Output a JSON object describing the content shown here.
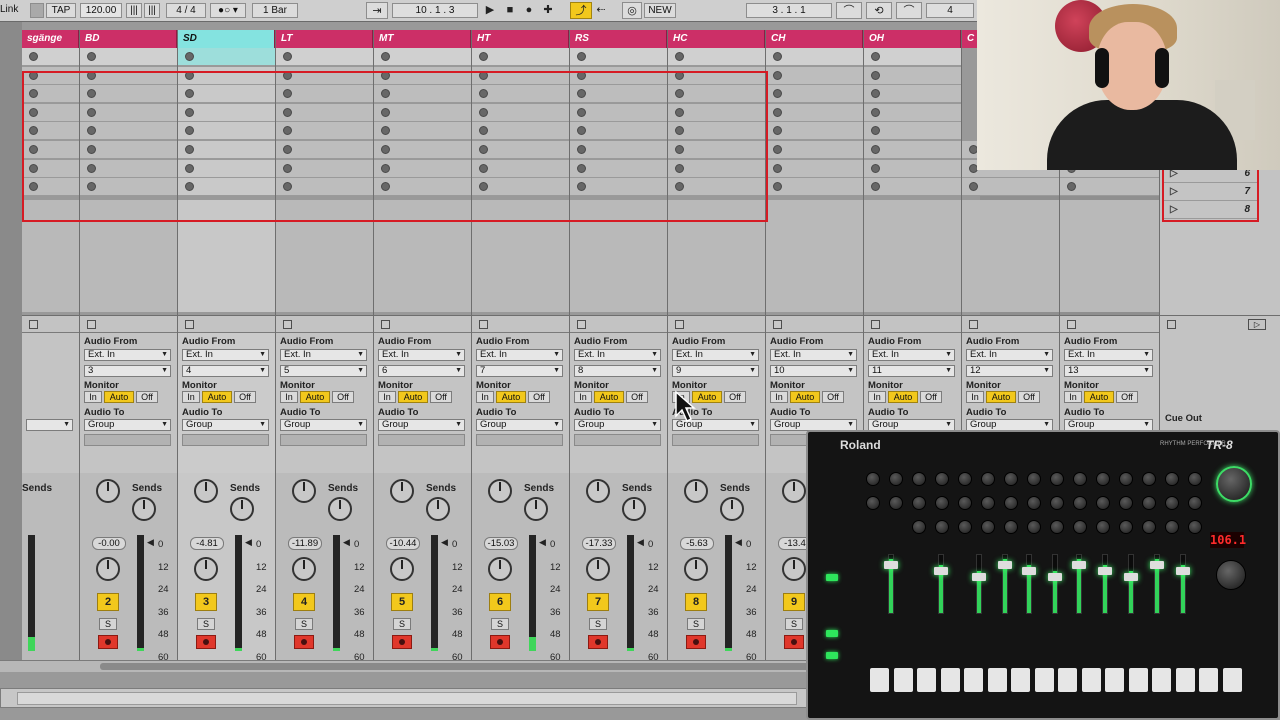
{
  "transport": {
    "link_label": "Link",
    "tap_label": "TAP",
    "tempo": "120.00",
    "meter_glyph": "|||",
    "time_signature": "4 / 4",
    "quantize": "1 Bar",
    "position": "10 .   1 .   3",
    "new_label": "NEW",
    "loop_position": "3 .   1 .   1",
    "loop_length": "4"
  },
  "tracks": [
    {
      "name": "sgänge",
      "input_channel": "",
      "volume": "",
      "number": "",
      "selected": false,
      "partial": true
    },
    {
      "name": "BD",
      "input_channel": "3",
      "volume": "-0.00",
      "number": "2",
      "selected": false
    },
    {
      "name": "SD",
      "input_channel": "4",
      "volume": "-4.81",
      "number": "3",
      "selected": true
    },
    {
      "name": "LT",
      "input_channel": "5",
      "volume": "-11.89",
      "number": "4",
      "selected": false
    },
    {
      "name": "MT",
      "input_channel": "6",
      "volume": "-10.44",
      "number": "5",
      "selected": false
    },
    {
      "name": "HT",
      "input_channel": "7",
      "volume": "-15.03",
      "number": "6",
      "selected": false
    },
    {
      "name": "RS",
      "input_channel": "8",
      "volume": "-17.33",
      "number": "7",
      "selected": false
    },
    {
      "name": "HC",
      "input_channel": "9",
      "volume": "-5.63",
      "number": "8",
      "selected": false
    },
    {
      "name": "CH",
      "input_channel": "10",
      "volume": "-13.4",
      "number": "9",
      "selected": false
    },
    {
      "name": "OH",
      "input_channel": "11",
      "volume": "",
      "number": "",
      "selected": false
    },
    {
      "name": "C",
      "input_channel": "12",
      "volume": "",
      "number": "",
      "selected": false
    },
    {
      "name": "",
      "input_channel": "13",
      "volume": "",
      "number": "",
      "selected": false
    }
  ],
  "io_labels": {
    "audio_from": "Audio From",
    "ext_in": "Ext. In",
    "monitor": "Monitor",
    "in": "In",
    "auto": "Auto",
    "off": "Off",
    "audio_to": "Audio To",
    "group": "Group",
    "sends": "Sends",
    "solo": "S"
  },
  "meter_scale": [
    "0",
    "12",
    "24",
    "36",
    "48",
    "60"
  ],
  "master": {
    "scenes": [
      "6",
      "7",
      "8"
    ],
    "cue_out": "Cue Out"
  },
  "tr8": {
    "brand": "Roland",
    "model": "TR-8",
    "subtitle": "RHYTHM PERFORMER",
    "tempo_display": "106.1"
  },
  "colors": {
    "track_header": "#cc2f67",
    "selected_header": "#84e3e0",
    "auto_yellow": "#f2c81c",
    "arm_red": "#e0372b",
    "meter_green": "#3fd65a",
    "highlight_box": "#d61b24"
  }
}
